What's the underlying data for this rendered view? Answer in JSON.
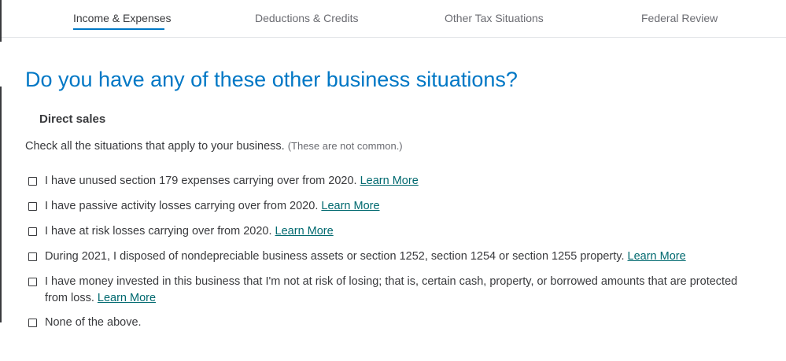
{
  "tabs": [
    {
      "label": "Income & Expenses",
      "active": true
    },
    {
      "label": "Deductions & Credits",
      "active": false
    },
    {
      "label": "Other Tax Situations",
      "active": false
    },
    {
      "label": "Federal Review",
      "active": false
    }
  ],
  "page": {
    "title": "Do you have any of these other business situations?",
    "section_title": "Direct sales",
    "instructions": "Check all the situations that apply to your business.",
    "instructions_note": "(These are not common.)"
  },
  "options": [
    {
      "text": "I have unused section 179 expenses carrying over from 2020.",
      "link": "Learn More",
      "checked": false
    },
    {
      "text": "I have passive activity losses carrying over from 2020.",
      "link": "Learn More",
      "checked": false
    },
    {
      "text": "I have at risk losses carrying over from 2020.",
      "link": "Learn More",
      "checked": false
    },
    {
      "text": "During 2021, I disposed of nondepreciable business assets or section 1252, section 1254 or section 1255 property.",
      "link": "Learn More",
      "checked": false
    },
    {
      "text": "I have money invested in this business that I'm not at risk of losing; that is, certain cash, property, or borrowed amounts that are protected from loss.",
      "link": "Learn More",
      "checked": false
    },
    {
      "text": "None of the above.",
      "link": "",
      "checked": false
    }
  ],
  "colors": {
    "accent": "#0077c5",
    "link": "#00696f",
    "text": "#393a3d",
    "muted": "#6b6c72"
  }
}
